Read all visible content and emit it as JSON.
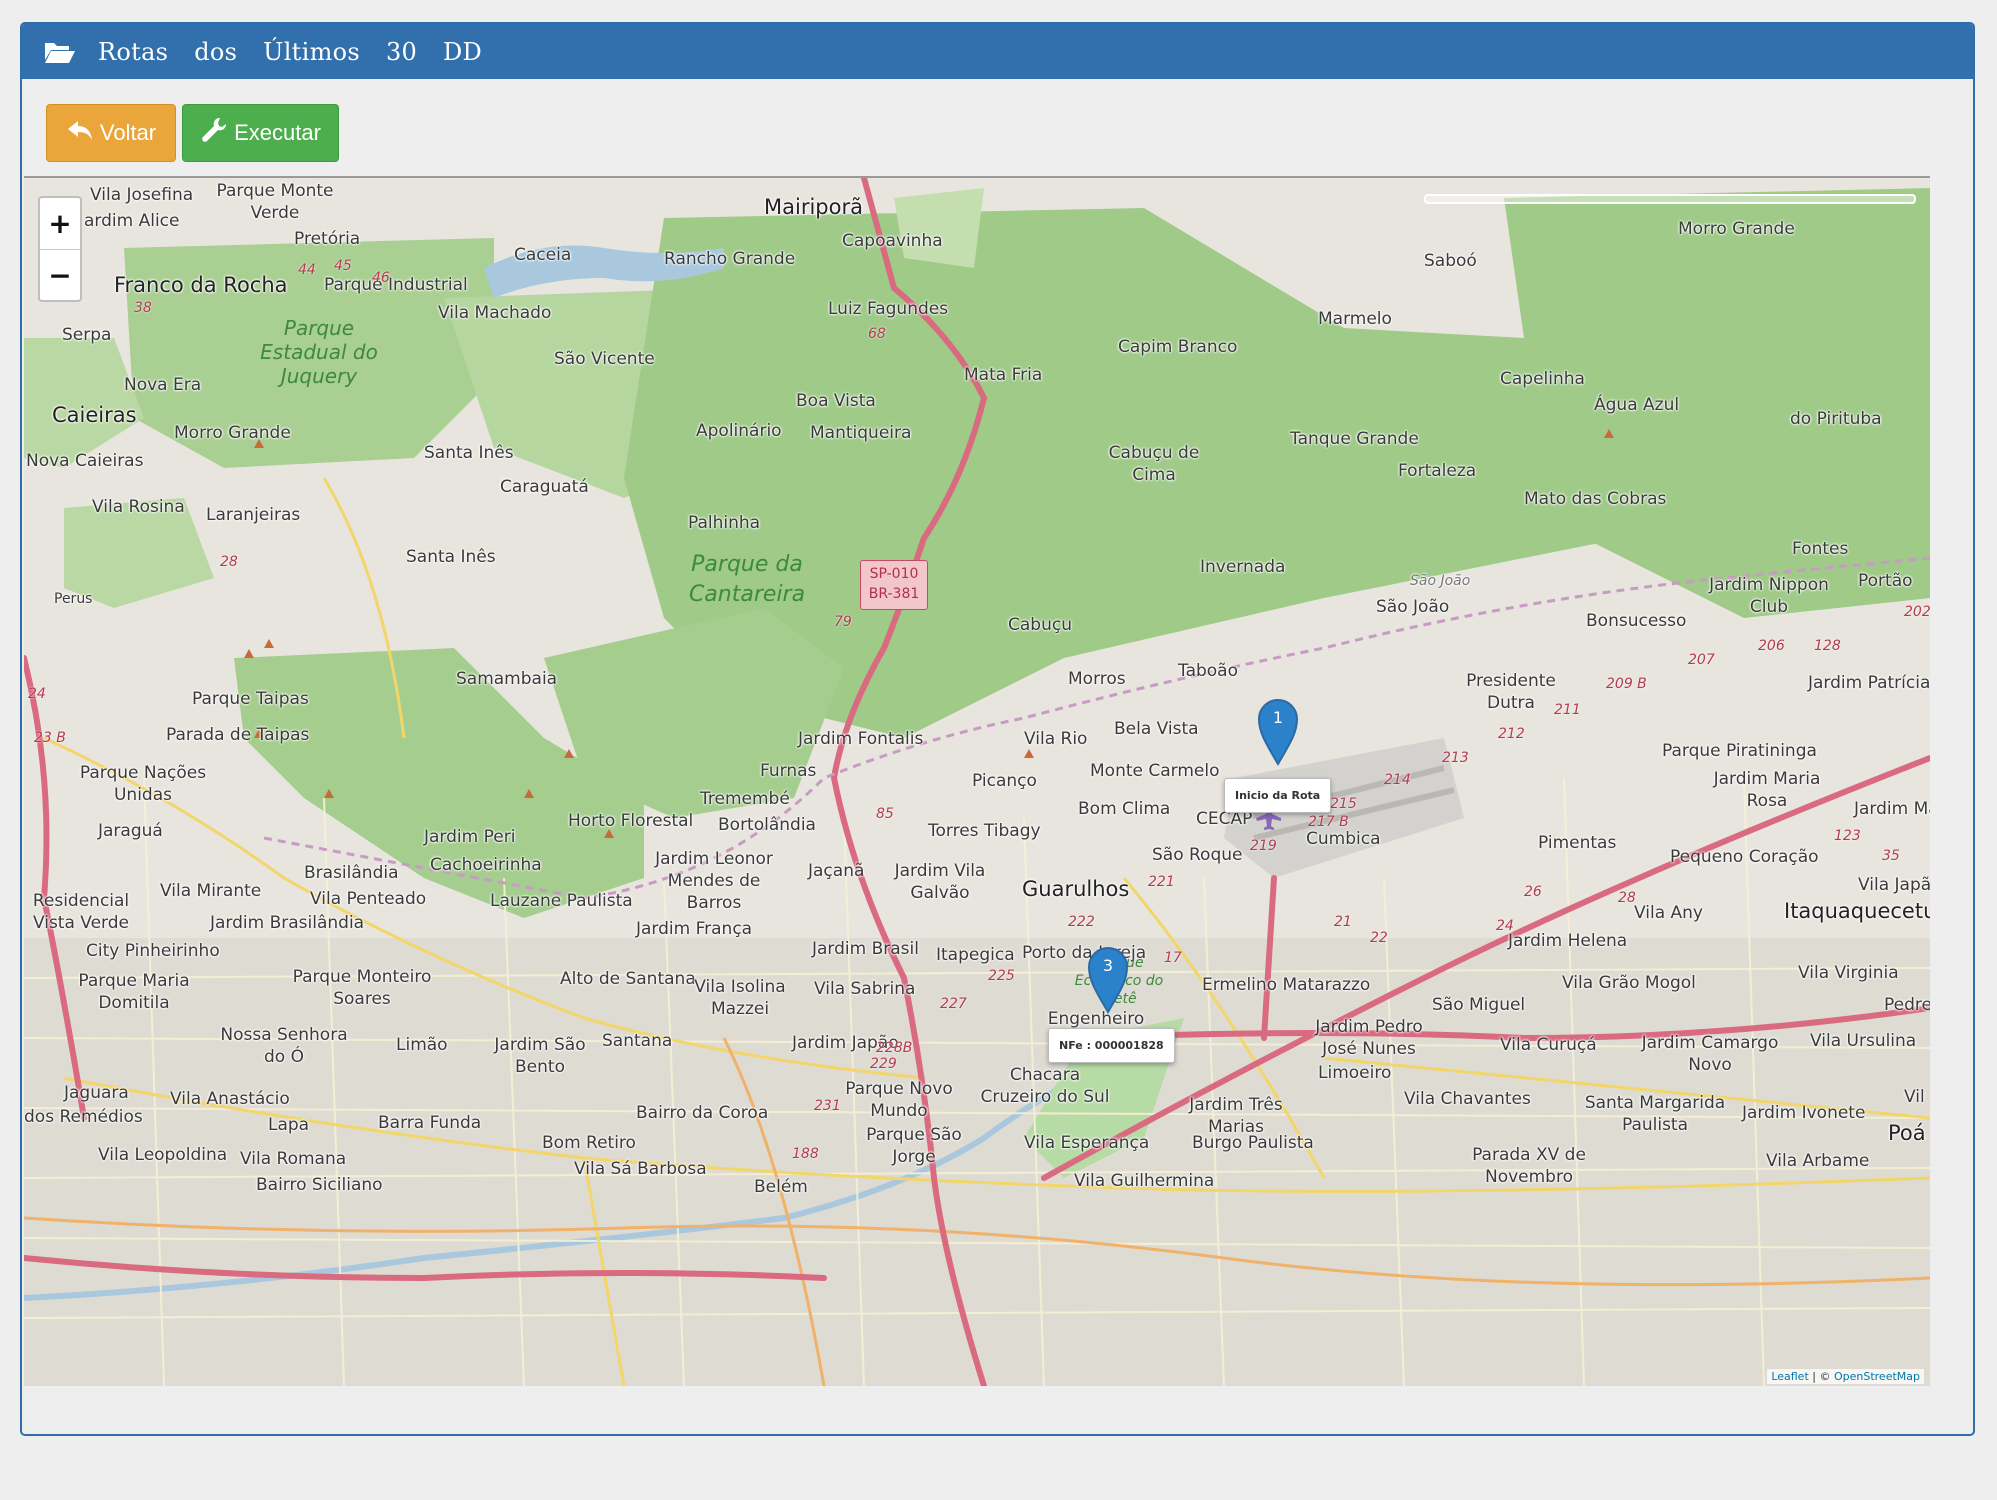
{
  "header": {
    "title": "Rotas dos Últimos 30 DD"
  },
  "toolbar": {
    "voltar_label": "Voltar",
    "executar_label": "Executar"
  },
  "map": {
    "zoom_in": "+",
    "zoom_out": "−",
    "attribution_leaflet": "Leaflet",
    "attribution_sep": " | © ",
    "attribution_osm": "OpenStreetMap",
    "markers": [
      {
        "number": "1",
        "popup": "Inicio da Rota",
        "color": "#2b82cb"
      },
      {
        "number": "3",
        "popup": "NFe : 000001828",
        "color": "#2b82cb"
      }
    ],
    "road_shield": [
      "SP-010",
      "BR-381"
    ],
    "places": {
      "mairipora": "Mairiporã",
      "capoavinha": "Capoavinha",
      "rancho_grande": "Rancho Grande",
      "caceia": "Caceia",
      "vila_josefina": "Vila Josefina",
      "parque_monte_verde": "Parque Monte Verde",
      "jardim_alice": "ardim Alice",
      "pretoria": "Pretória",
      "franco_da_rocha": "Franco da Rocha",
      "parque_industrial": "Parque Industrial",
      "vila_machado": "Vila Machado",
      "luiz_fagundes": "Luiz Fagundes",
      "serpa": "Serpa",
      "parque_juquery": "Parque Estadual do Juquery",
      "sao_vicente": "São Vicente",
      "mata_fria": "Mata Fria",
      "capim_branco": "Capim Branco",
      "marmelo": "Marmelo",
      "saboo": "Saboó",
      "morro_grande_ne": "Morro Grande",
      "nova_era": "Nova Era",
      "caieiras": "Caieiras",
      "morro_grande": "Morro Grande",
      "boa_vista": "Boa Vista",
      "apolinario": "Apolinário",
      "mantiqueira": "Mantiqueira",
      "capelinha": "Capelinha",
      "agua_azul": "Água Azul",
      "do_pirituba": "do Pirituba",
      "nova_caieiras": "Nova Caieiras",
      "santa_ines": "Santa Inês",
      "caraguata": "Caraguatá",
      "cabucu_de_cima": "Cabuçu de Cima",
      "tanque_grande": "Tanque Grande",
      "fortaleza": "Fortaleza",
      "vila_rosina": "Vila Rosina",
      "laranjeiras": "Laranjeiras",
      "palhinha": "Palhinha",
      "mato_das_cobras": "Mato das Cobras",
      "santa_ines_2": "Santa Inês",
      "parque_cantareira": "Parque da Cantareira",
      "invernada": "Invernada",
      "sao_joao_small": "São João",
      "fontes": "Fontes",
      "portao": "Portão",
      "perus": "Perus",
      "jardim_nippon_club": "Jardim Nippon Club",
      "sao_joao": "São João",
      "bonsucesso": "Bonsucesso",
      "cabucu": "Cabuçu",
      "samambaia": "Samambaia",
      "morros": "Morros",
      "tabaao": "Taboão",
      "presidente_dutra": "Presidente Dutra",
      "jardim_patricia": "Jardim Patrícia",
      "parque_taipas": "Parque Taipas",
      "parada_de_taipas": "Parada de Taipas",
      "jardim_fontalis": "Jardim Fontalis",
      "vila_rio": "Vila Rio",
      "bela_vista": "Bela Vista",
      "parque_piratininga": "Parque Piratininga",
      "parque_nacoes_unidas": "Parque Nações Unidas",
      "furnas": "Furnas",
      "picanco": "Picanço",
      "monte_carmelo": "Monte Carmelo",
      "jardim_maria_rosa": "Jardim Maria Rosa",
      "tremembe": "Tremembé",
      "bom_clima": "Bom Clima",
      "jaragua": "Jaraguá",
      "horto_florestal": "Horto Florestal",
      "bortolandia": "Bortolândia",
      "torres_tibagy": "Torres Tibagy",
      "cecap": "CECAP",
      "cumbica": "Cumbica",
      "pimentas": "Pimentas",
      "jardim_ma": "Jardim Ma",
      "jardim_peri": "Jardim Peri",
      "brasilandia": "Brasilândia",
      "cachoeirinha": "Cachoeirinha",
      "jardim_leonor": "Jardim Leonor Mendes de Barros",
      "jacana": "Jaçanã",
      "jardim_vila_galvao": "Jardim Vila Galvão",
      "guarulhos": "Guarulhos",
      "sao_roque": "São Roque",
      "pequeno_coracao": "Pequeno Coração",
      "residencial_vista_verde": "Residencial Vista Verde",
      "vila_mirante": "Vila Mirante",
      "vila_penteado": "Vila Penteado",
      "lauzane_paulista": "Lauzane Paulista",
      "vila_japao": "Vila Japão",
      "jardim_brasilandia": "Jardim Brasilândia",
      "jardim_franca": "Jardim França",
      "vila_any": "Vila Any",
      "itaquaquecetuba": "Itaquaquecetu",
      "city_pinheirinho": "City Pinheirinho",
      "jardim_brasil": "Jardim Brasil",
      "itapegica": "Itapegica",
      "porto_da_igreja": "Porto da Igreja",
      "jardim_helena": "Jardim Helena",
      "parque_maria_domitila": "Parque Maria Domitila",
      "parque_monteiro_soares": "Parque Monteiro Soares",
      "alto_de_santana": "Alto de Santana",
      "vila_isolina_mazzei": "Vila Isolina Mazzei",
      "vila_sabrina": "Vila Sabrina",
      "parque_ecologico_tiete": "Parque Ecológico do Tietê",
      "ermelino_matarazzo": "Ermelino Matarazzo",
      "vila_grao_mogol": "Vila Grão Mogol",
      "vila_virginia": "Vila Virginia",
      "pedre": "Pedre",
      "sao_miguel": "São Miguel",
      "nossa_senhora_do_o": "Nossa Senhora do Ó",
      "limao": "Limão",
      "jardim_sao_bento": "Jardim São Bento",
      "santana": "Santana",
      "jardim_japao": "Jardim Japão",
      "engenheiro_goulart": "Engenheiro Goulart",
      "jardim_pedro_jose_nunes": "Jardim Pedro José Nunes",
      "vila_curuca": "Vila Curuçá",
      "jardim_camargo_novo": "Jardim Camargo Novo",
      "vila_ursulina": "Vila Ursulina",
      "jaguara": "Jaguara",
      "vila_anastacio": "Vila Anastácio",
      "chacara_cruzeiro_do_sul": "Chacara Cruzeiro do Sul",
      "limoeiro": "Limoeiro",
      "parque_novo_mundo": "Parque Novo Mundo",
      "vila_chavantes": "Vila Chavantes",
      "dos_remedios": "dos Remédios",
      "lapa": "Lapa",
      "barra_funda": "Barra Funda",
      "bairro_da_coroa": "Bairro da Coroa",
      "jardim_tres_marias": "Jardim Três Marias",
      "santa_margarida_paulista": "Santa Margarida Paulista",
      "jardim_ivonete": "Jardim Ivonete",
      "vila": "Vil",
      "bom_retiro": "Bom Retiro",
      "parque_sao_jorge": "Parque São Jorge",
      "vila_esperanca": "Vila Esperança",
      "burgo_paulista": "Burgo Paulista",
      "poa": "Poá",
      "vila_leopoldina": "Vila Leopoldina",
      "vila_romana": "Vila Romana",
      "vila_sa_barbosa": "Vila Sá Barbosa",
      "parada_xv": "Parada XV de Novembro",
      "vila_arbame": "Vila Arbame",
      "bairro_siciliano": "Bairro Siciliano",
      "vila_guilhermina": "Vila Guilhermina",
      "belem": "Belém"
    },
    "road_numbers": [
      "44",
      "45",
      "46",
      "38",
      "68",
      "28",
      "79",
      "85",
      "24",
      "23 B",
      "202",
      "206",
      "207",
      "128",
      "209 B",
      "211",
      "212",
      "213",
      "214",
      "215",
      "217 B",
      "219",
      "221",
      "222",
      "225",
      "227",
      "228B",
      "229",
      "231",
      "188",
      "26",
      "28",
      "24",
      "123",
      "35",
      "17",
      "21",
      "22"
    ]
  }
}
